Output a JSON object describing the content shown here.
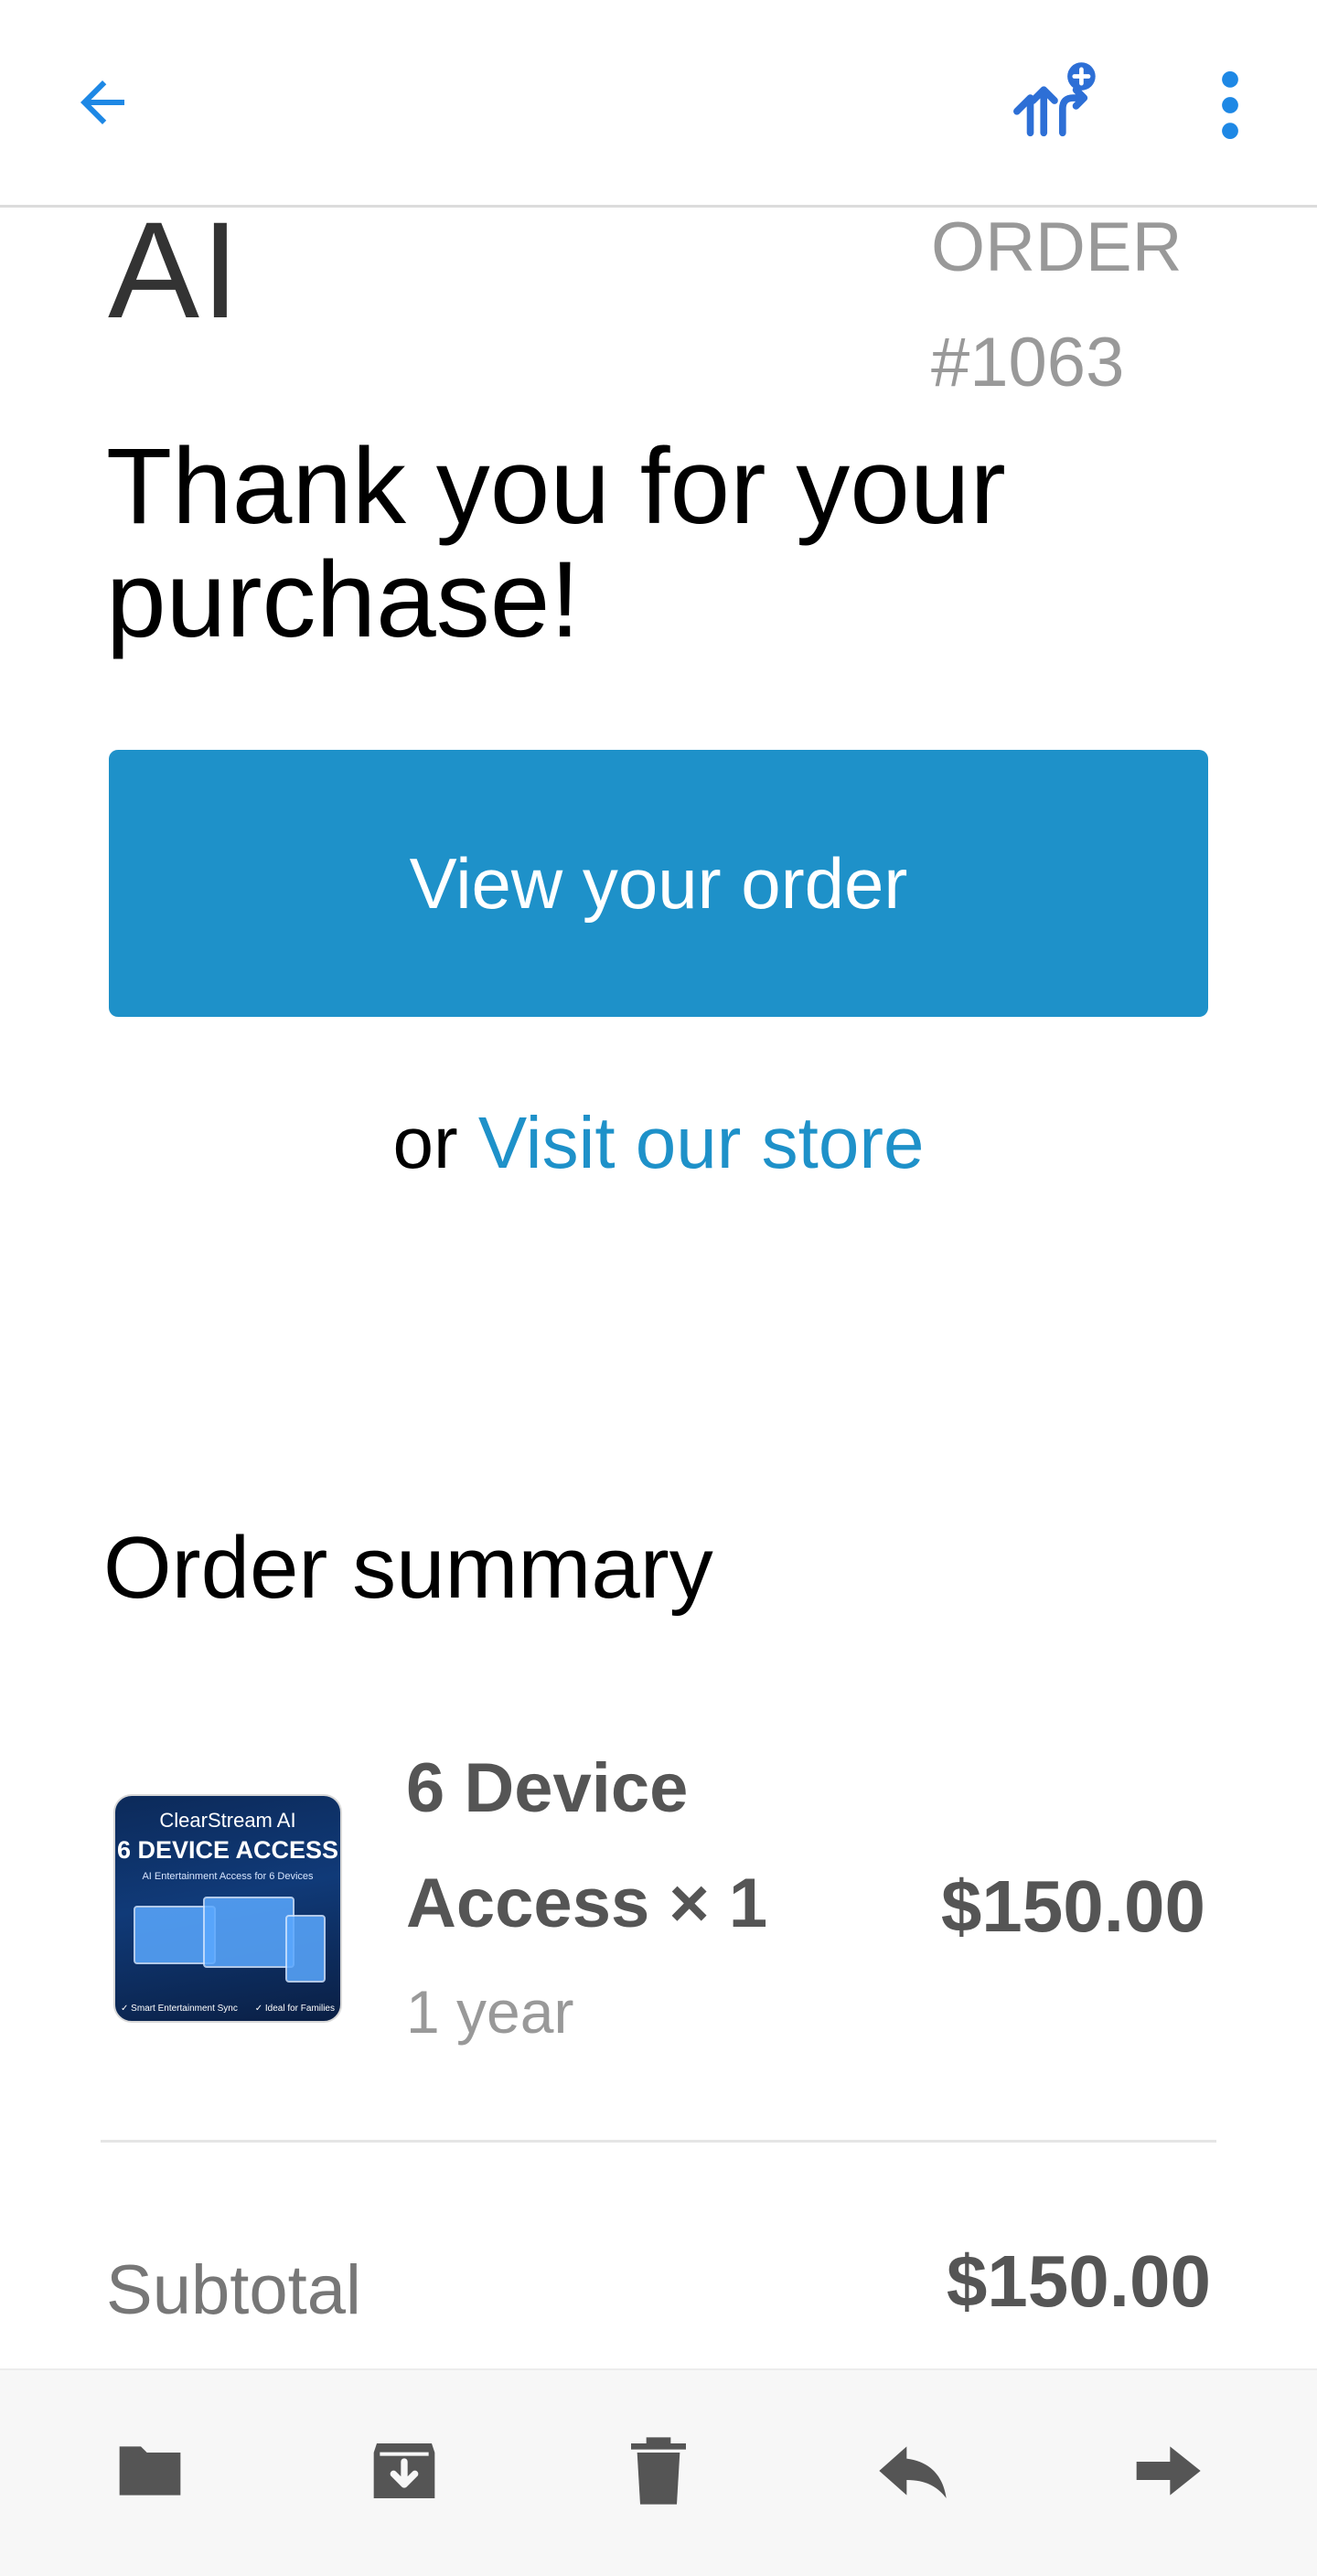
{
  "top_bar": {
    "back_icon": "arrow-left-icon",
    "addons_icon": "add-ons-icon",
    "more_icon": "more-vertical-icon",
    "accent_color": "#1e88e5"
  },
  "email": {
    "logo_text": "AI",
    "order_label": "ORDER",
    "order_number": "#1063",
    "headline": "Thank you for your purchase!",
    "view_order_label": "View your order",
    "or_text": "or",
    "visit_store_label": "Visit our store",
    "button_color": "#1e91c9"
  },
  "summary": {
    "title": "Order summary",
    "items": [
      {
        "image_text": {
          "brand": "ClearStream AI",
          "headline": "6 DEVICE ACCESS",
          "subline": "AI Entertainment Access for 6 Devices",
          "feature_left": "✓ Smart Entertainment Sync",
          "feature_right": "✓ Ideal for Families"
        },
        "name": "6 Device Access × 1",
        "variant": "1 year",
        "price": "$150.00"
      }
    ],
    "subtotal_label": "Subtotal",
    "subtotal_value": "$150.00"
  },
  "bottom_bar": {
    "icons": [
      "folder-icon",
      "archive-icon",
      "trash-icon",
      "reply-icon",
      "forward-icon"
    ]
  }
}
